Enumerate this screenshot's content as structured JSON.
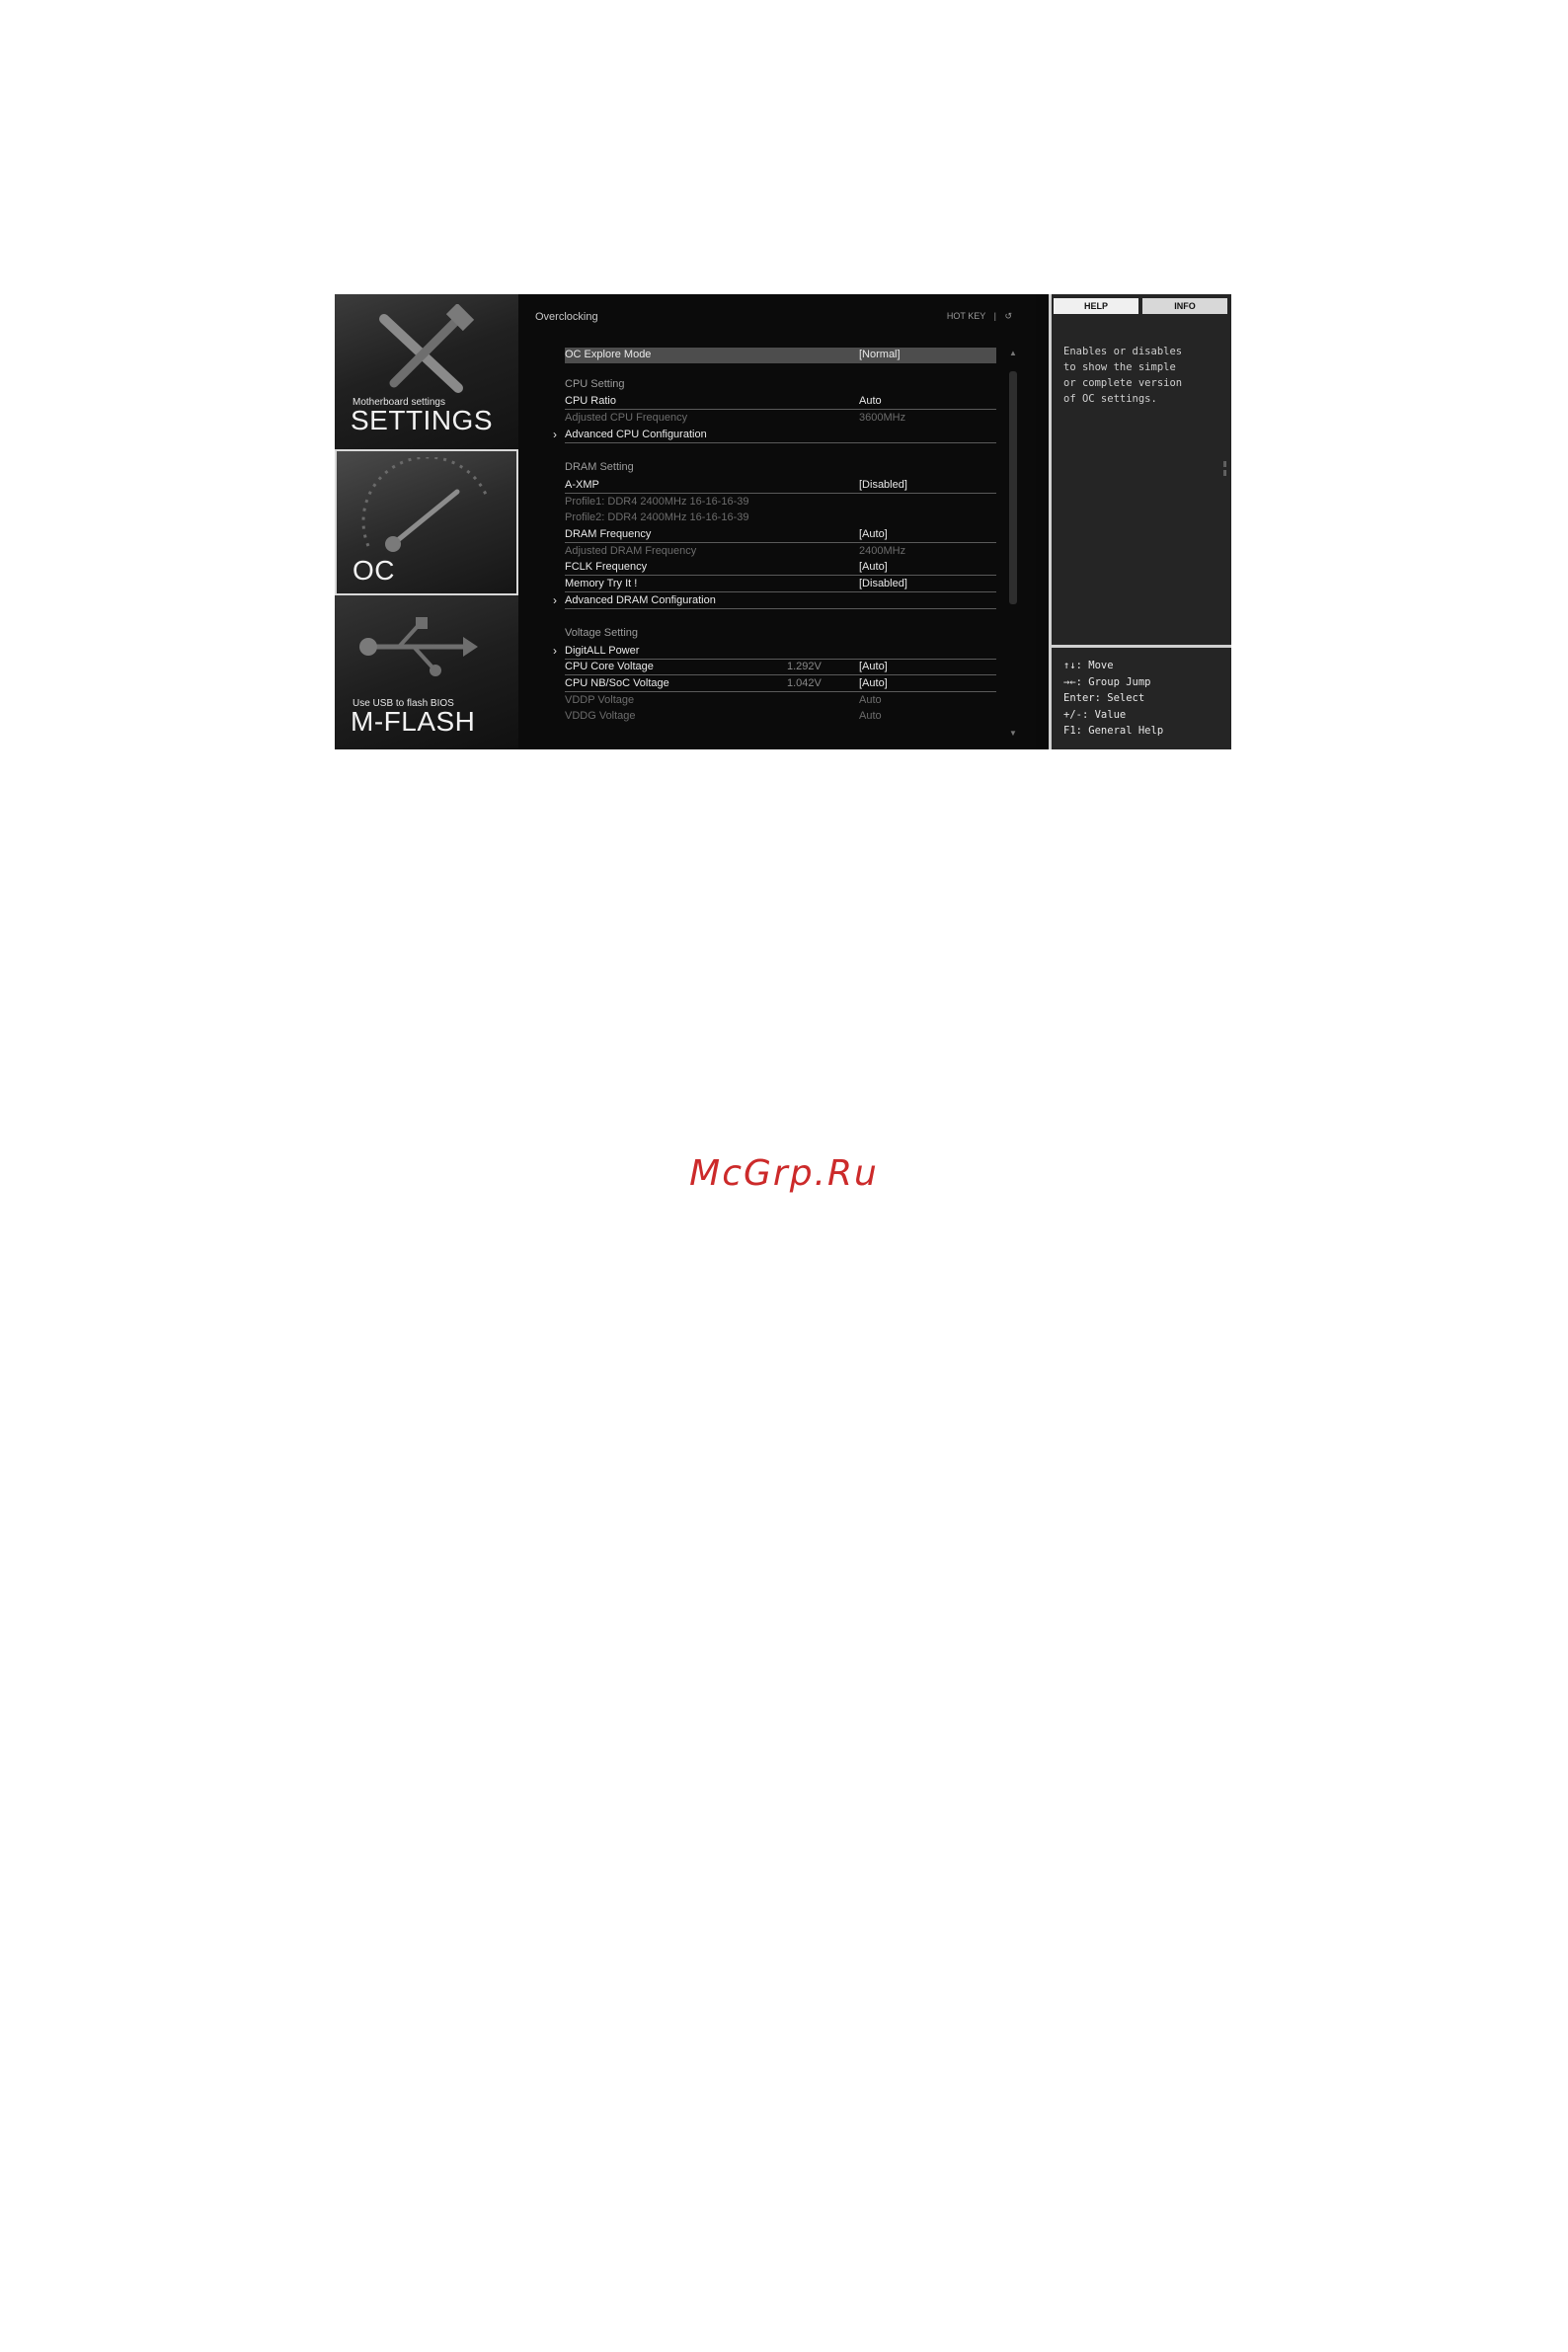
{
  "sidebar": {
    "tiles": [
      {
        "small": "Motherboard settings",
        "big": "SETTINGS"
      },
      {
        "small": "",
        "big": "OC"
      },
      {
        "small": "Use USB to flash BIOS",
        "big": "M-FLASH"
      }
    ]
  },
  "header": {
    "title": "Overclocking",
    "hotkey": "HOT KEY",
    "separator": "|",
    "back_glyph": "↺"
  },
  "settings": {
    "oc_explore": {
      "label": "OC Explore Mode",
      "value": "[Normal]"
    },
    "cpu_section": "CPU Setting",
    "cpu_ratio": {
      "label": "CPU Ratio",
      "value": "Auto"
    },
    "adj_cpu_freq": {
      "label": "Adjusted CPU Frequency",
      "value": "3600MHz"
    },
    "adv_cpu": {
      "label": "Advanced CPU Configuration"
    },
    "dram_section": "DRAM Setting",
    "axmp": {
      "label": "A-XMP",
      "value": "[Disabled]"
    },
    "profile1": {
      "label": "Profile1: DDR4 2400MHz 16-16-16-39"
    },
    "profile2": {
      "label": "Profile2: DDR4 2400MHz 16-16-16-39"
    },
    "dram_freq": {
      "label": "DRAM Frequency",
      "value": "[Auto]"
    },
    "adj_dram_freq": {
      "label": "Adjusted DRAM Frequency",
      "value": "2400MHz"
    },
    "fclk": {
      "label": "FCLK Frequency",
      "value": "[Auto]"
    },
    "memtry": {
      "label": "Memory Try It !",
      "value": "[Disabled]"
    },
    "adv_dram": {
      "label": "Advanced DRAM Configuration"
    },
    "volt_section": "Voltage Setting",
    "digitall": {
      "label": "DigitALL Power"
    },
    "cpu_core_v": {
      "label": "CPU Core Voltage",
      "reading": "1.292V",
      "value": "[Auto]"
    },
    "cpu_nb_v": {
      "label": "CPU NB/SoC Voltage",
      "reading": "1.042V",
      "value": "[Auto]"
    },
    "vddp": {
      "label": "VDDP Voltage",
      "value": "Auto"
    },
    "vddg": {
      "label": "VDDG Voltage",
      "value": "Auto"
    }
  },
  "help": {
    "tab_help": "HELP",
    "tab_info": "INFO",
    "text": "Enables or disables\nto show the simple\nor complete version\nof OC settings.",
    "keys": [
      "↑↓: Move",
      "→←: Group Jump",
      "Enter: Select",
      "+/-: Value",
      "F1: General Help"
    ]
  },
  "watermark": "McGrp.Ru"
}
